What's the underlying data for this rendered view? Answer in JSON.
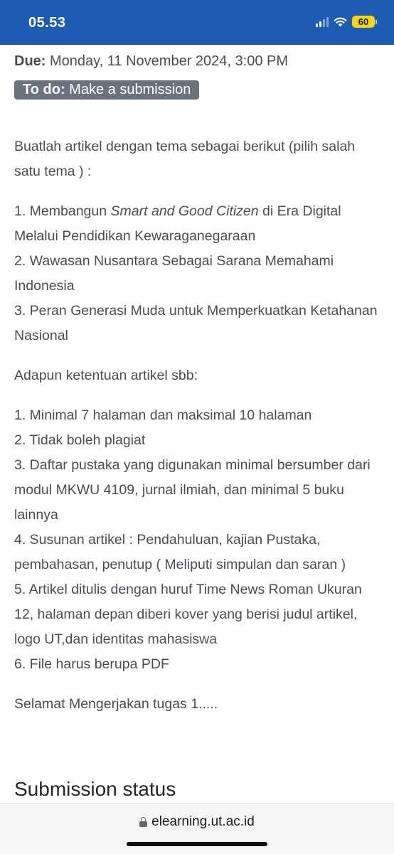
{
  "status_bar": {
    "time": "05.53",
    "battery": "60",
    "icons": [
      "cellular-signal-icon",
      "wifi-icon",
      "battery-icon"
    ],
    "background": "#1f5bb0"
  },
  "assignment": {
    "due_label": "Due:",
    "due_value": "Monday, 11 November 2024, 3:00 PM",
    "todo_label": "To do:",
    "todo_value": "Make a submission"
  },
  "description": {
    "intro": "Buatlah artikel dengan tema sebagai berikut (pilih salah satu tema ) :",
    "theme1_prefix": "1. Membangun ",
    "theme1_italic": "Smart and Good Citizen",
    "theme1_suffix": " di Era Digital  Melalui Pendidikan Kewaraganegaraan",
    "theme2": "2. Wawasan Nusantara Sebagai Sarana Memahami Indonesia",
    "theme3": "3. Peran Generasi Muda untuk Memperkuatkan Ketahanan Nasional",
    "rules_intro": "Adapun ketentuan artikel sbb:",
    "rules": [
      "1. Minimal 7 halaman dan maksimal 10 halaman",
      "2. Tidak boleh plagiat",
      "3. Daftar pustaka yang digunakan minimal bersumber dari modul MKWU 4109, jurnal ilmiah, dan minimal 5 buku lainnya",
      "4. Susunan artikel : Pendahuluan, kajian Pustaka, pembahasan, penutup ( Meliputi simpulan dan saran )",
      "5. Artikel ditulis dengan huruf Time News Roman Ukuran 12, halaman depan diberi kover yang berisi judul artikel, logo UT,dan identitas mahasiswa",
      "6. File harus berupa PDF"
    ],
    "closing": "Selamat Mengerjakan tugas 1....."
  },
  "section": {
    "submission_status": "Submission status"
  },
  "browser": {
    "url": "elearning.ut.ac.id"
  }
}
